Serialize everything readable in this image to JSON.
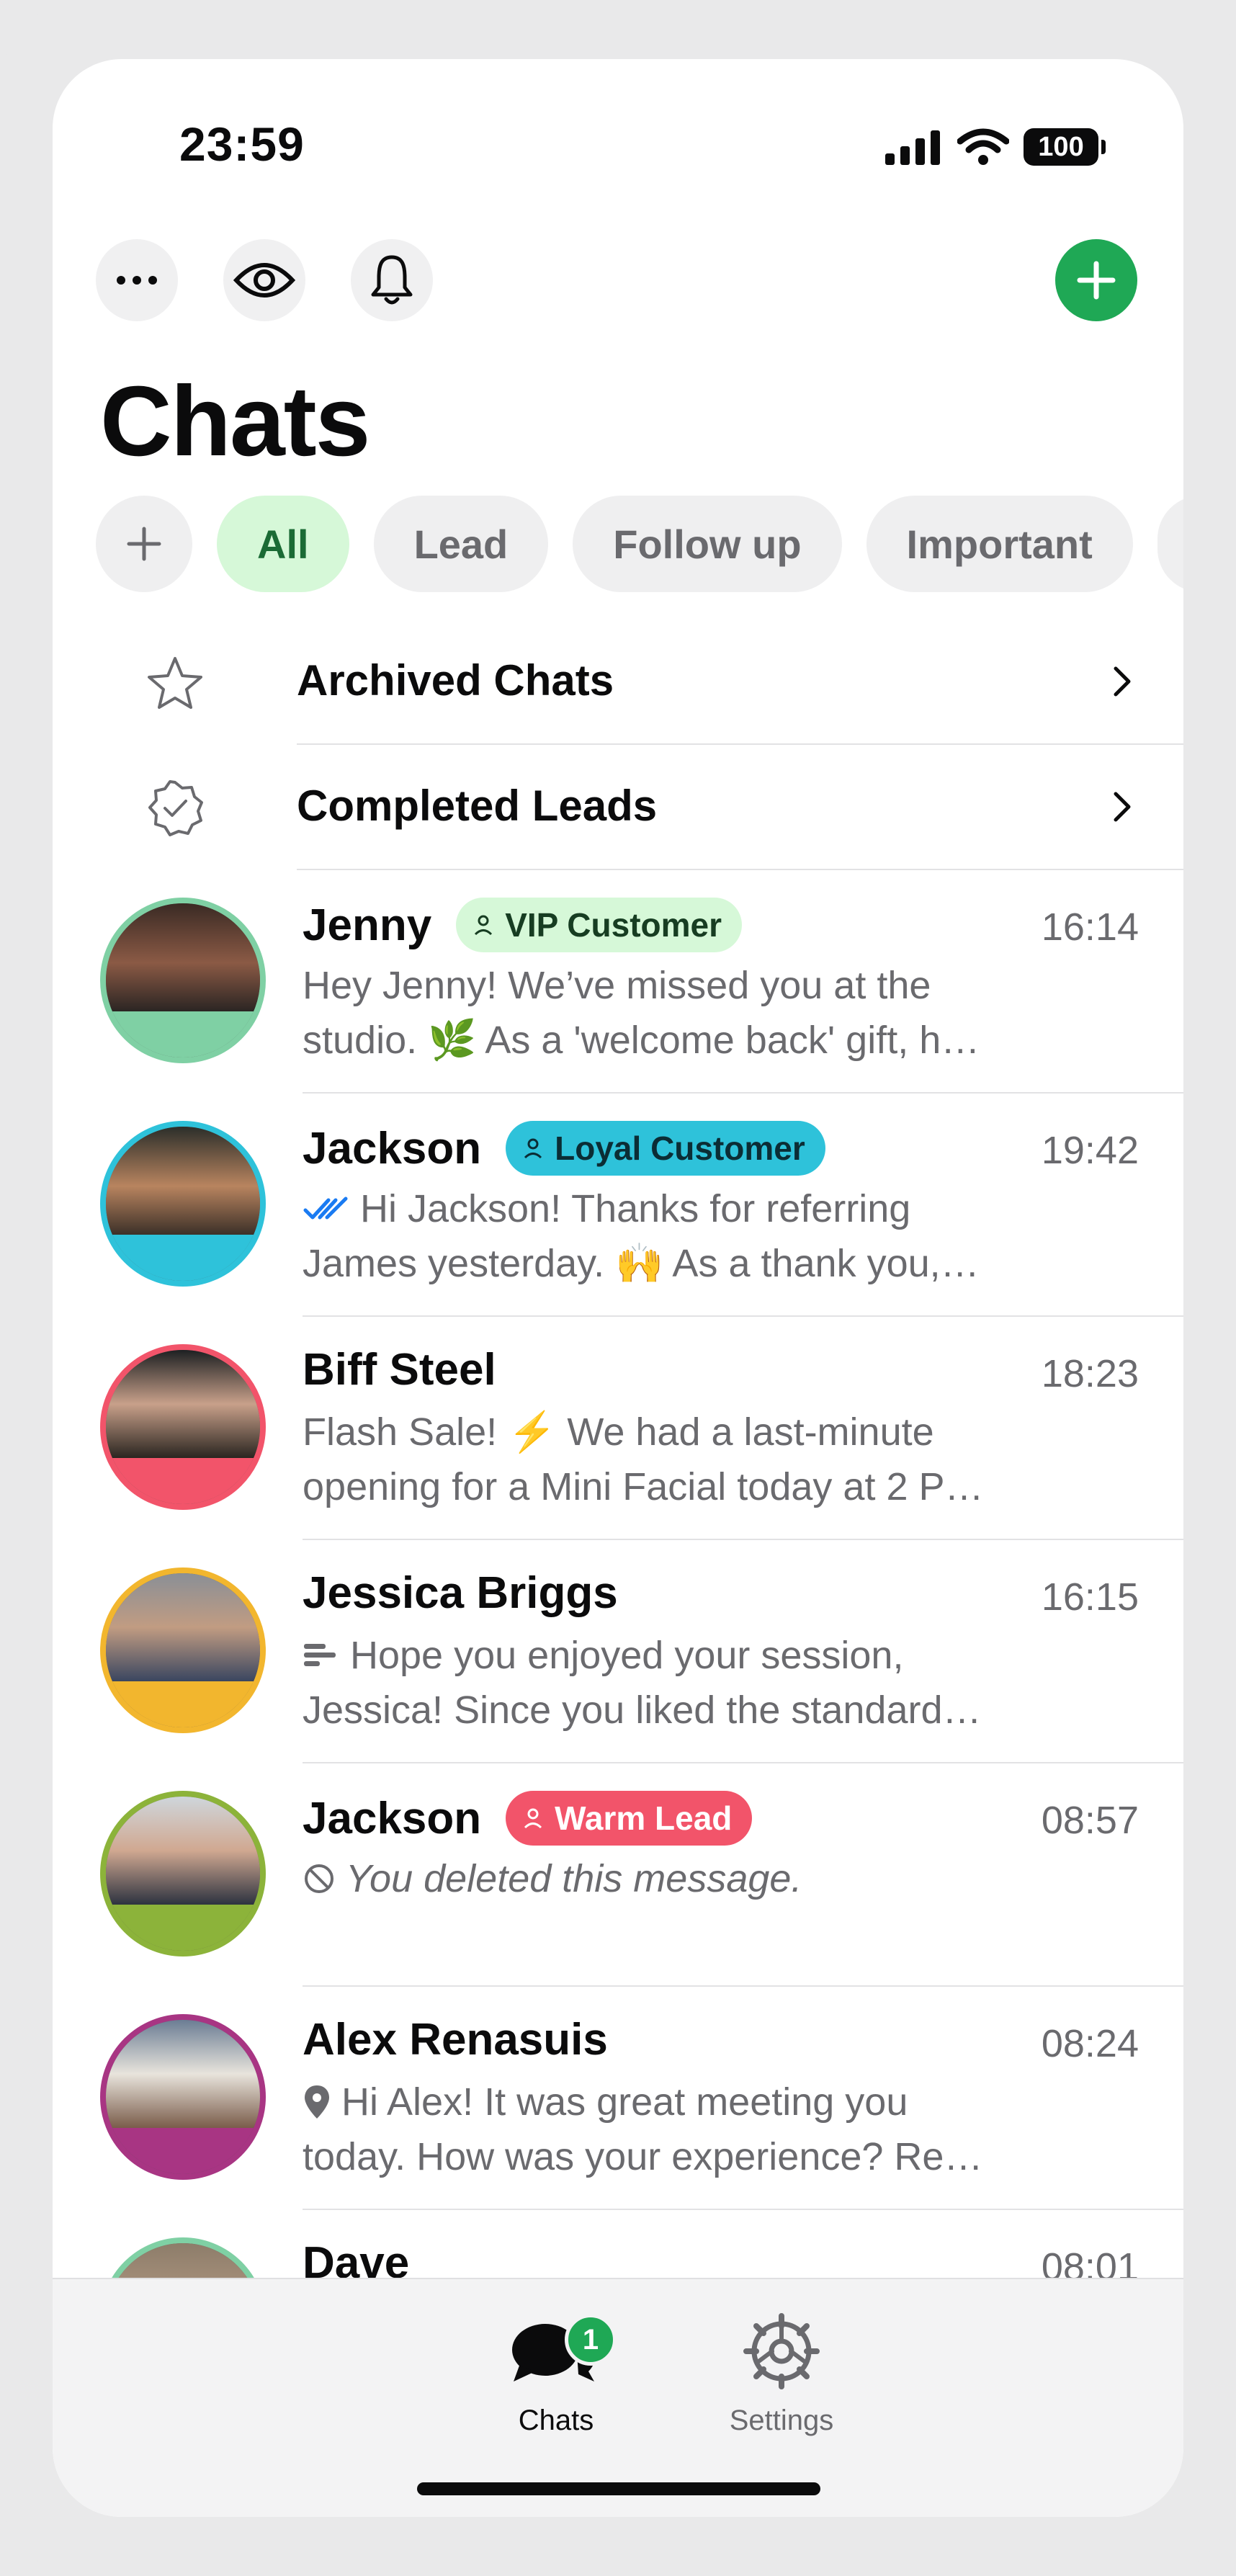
{
  "status": {
    "time": "23:59",
    "battery": "100"
  },
  "header": {
    "title": "Chats"
  },
  "filters": [
    "All",
    "Lead",
    "Follow up",
    "Important"
  ],
  "links": {
    "archived": "Archived Chats",
    "completed": "Completed Leads"
  },
  "chats": [
    {
      "name": "Jenny",
      "tag": "VIP Customer",
      "time": "16:14",
      "line1": "Hey Jenny! We’ve missed you at the",
      "line2": "studio. 🌿 As a 'welcome back' gift, h…",
      "ring": "#7fd0a4"
    },
    {
      "name": "Jackson",
      "tag": "Loyal Customer",
      "time": "19:42",
      "line1": "Hi Jackson! Thanks for referring",
      "line2": "James yesterday. 🙌 As a thank you,…",
      "ring": "#2ec2da"
    },
    {
      "name": "Biff Steel",
      "time": "18:23",
      "line1": "Flash Sale! ⚡ We had a last-minute",
      "line2": "opening for a Mini Facial today at 2 P…",
      "ring": "#f2546a"
    },
    {
      "name": "Jessica Briggs",
      "time": "16:15",
      "line1": "Hope you enjoyed your session,",
      "line2": "Jessica! Since you liked the standard…",
      "ring": "#f2b62e"
    },
    {
      "name": "Jackson",
      "tag": "Warm Lead",
      "time": "08:57",
      "line1": "You deleted this message.",
      "ring": "#8cb33a"
    },
    {
      "name": "Alex Renasuis",
      "time": "08:24",
      "line1": "Hi Alex! It was great meeting you",
      "line2": "today. How was your experience? Re…",
      "ring": "#a83583"
    },
    {
      "name": "Dave",
      "time": "08:01",
      "ring": "#7fd0a4"
    }
  ],
  "tabs": {
    "chats": "Chats",
    "settings": "Settings",
    "chats_badge": "1"
  }
}
